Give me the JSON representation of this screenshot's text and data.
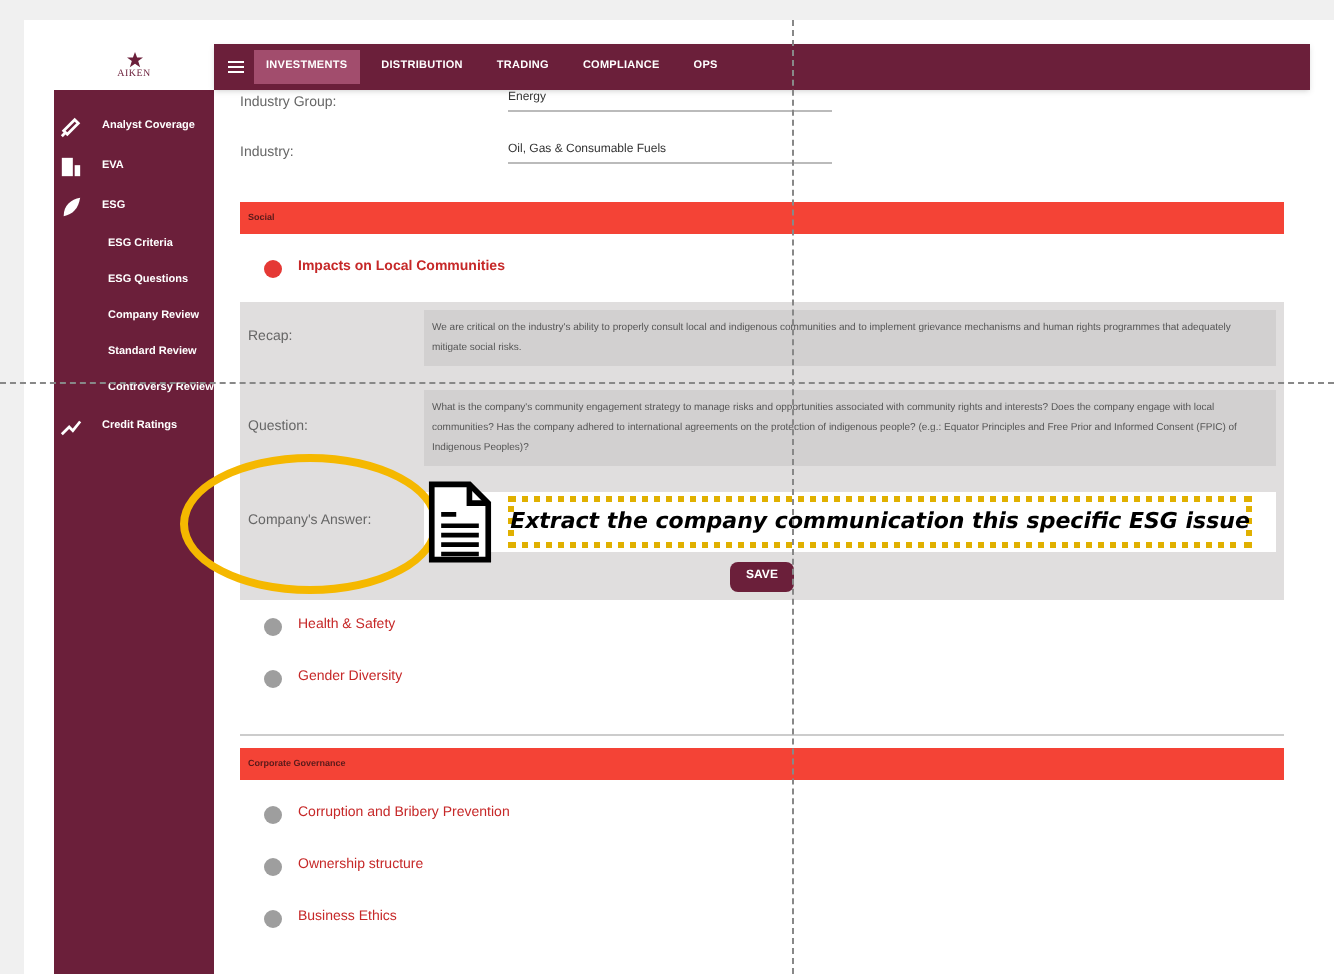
{
  "logo": {
    "text": "AIKEN"
  },
  "nav_tabs": [
    {
      "label": "INVESTMENTS",
      "selected": true
    },
    {
      "label": "DISTRIBUTION",
      "selected": false
    },
    {
      "label": "TRADING",
      "selected": false
    },
    {
      "label": "COMPLIANCE",
      "selected": false
    },
    {
      "label": "OPS",
      "selected": false
    }
  ],
  "sidebar": {
    "items": [
      {
        "label": "Analyst Coverage"
      },
      {
        "label": "EVA"
      },
      {
        "label": "ESG",
        "children": [
          {
            "label": "ESG Criteria"
          },
          {
            "label": "ESG Questions"
          },
          {
            "label": "Company Review"
          },
          {
            "label": "Standard Review"
          },
          {
            "label": "Controversy Review"
          }
        ]
      },
      {
        "label": "Credit Ratings"
      }
    ]
  },
  "fields": [
    {
      "label": "Industry Group:",
      "value": "Energy"
    },
    {
      "label": "Industry:",
      "value": "Oil, Gas & Consumable Fuels"
    }
  ],
  "sections": [
    {
      "title": "Social",
      "topics": [
        {
          "title": "Impacts on Local Communities",
          "expanded": true,
          "recap_label": "Recap:",
          "recap": "We are critical on the industry's ability to properly consult local and indigenous communities and to implement grievance mechanisms and human rights programmes that adequately mitigate social risks.",
          "question_label": "Question:",
          "question": "What is the company's community engagement strategy to manage risks and opportunities associated with community rights and interests? Does the company engage with local communities? Has the company adhered to international agreements on the protection of indigenous people? (e.g.: Equator Principles and Free Prior and Informed Consent (FPIC) of Indigenous Peoples)?",
          "answer_label": "Company's Answer:",
          "save": "SAVE"
        },
        {
          "title": "Health & Safety",
          "expanded": false
        },
        {
          "title": "Gender Diversity",
          "expanded": false
        }
      ]
    },
    {
      "title": "Corporate Governance",
      "topics": [
        {
          "title": "Corruption and Bribery Prevention",
          "expanded": false
        },
        {
          "title": "Ownership structure",
          "expanded": false
        },
        {
          "title": "Business Ethics",
          "expanded": false
        }
      ]
    }
  ],
  "annotation": {
    "text": "Extract the company communication this specific ESG issue"
  }
}
